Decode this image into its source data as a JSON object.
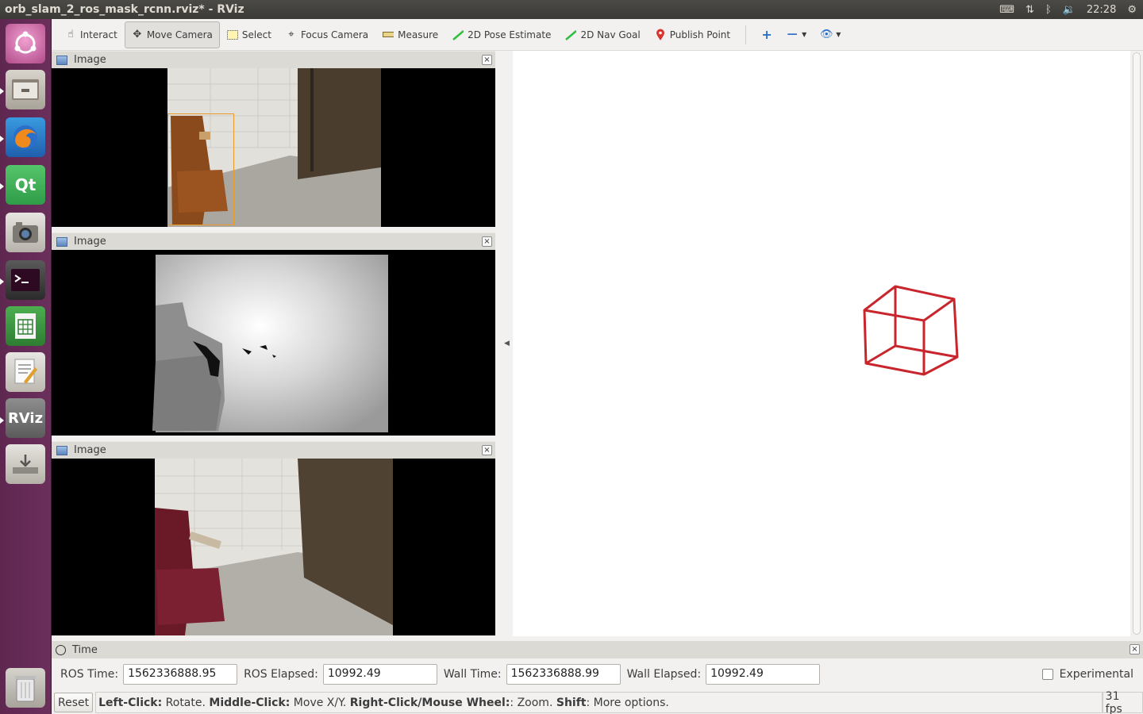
{
  "window": {
    "title": "orb_slam_2_ros_mask_rcnn.rviz* - RViz",
    "clock": "22:28"
  },
  "launcher": {
    "items": [
      "ubuntu-icon",
      "files-icon",
      "firefox-icon",
      "qt-creator-icon",
      "camera-icon",
      "terminal-icon",
      "spreadsheet-icon",
      "text-editor-icon",
      "rviz-icon",
      "installer-icon",
      "trash-icon"
    ],
    "qt_label": "Qt",
    "rviz_label": "RViz"
  },
  "toolbar": {
    "tools": {
      "interact": "Interact",
      "move_camera": "Move Camera",
      "select": "Select",
      "focus_camera": "Focus Camera",
      "measure": "Measure",
      "pose_estimate": "2D Pose Estimate",
      "nav_goal": "2D Nav Goal",
      "publish_point": "Publish Point"
    },
    "active_tool": "Move Camera"
  },
  "panels": {
    "image1_title": "Image",
    "image2_title": "Image",
    "image3_title": "Image",
    "close_glyph": "×"
  },
  "time_panel": {
    "title": "Time",
    "ros_time_label": "ROS Time:",
    "ros_time_value": "1562336888.95",
    "ros_elapsed_label": "ROS Elapsed:",
    "ros_elapsed_value": "10992.49",
    "wall_time_label": "Wall Time:",
    "wall_time_value": "1562336888.99",
    "wall_elapsed_label": "Wall Elapsed:",
    "wall_elapsed_value": "10992.49",
    "experimental_label": "Experimental",
    "experimental_checked": false
  },
  "status_bar": {
    "reset_label": "Reset",
    "left_click": "Left-Click:",
    "left_click_desc": " Rotate. ",
    "middle_click": "Middle-Click:",
    "middle_click_desc": " Move X/Y. ",
    "right_click": "Right-Click/Mouse Wheel:",
    "right_click_desc": ": Zoom. ",
    "shift": "Shift",
    "shift_desc": ": More options.",
    "fps": "31 fps"
  },
  "colors": {
    "camera_frustum": "#c8262c",
    "launcher_bg": "#5e2750",
    "detection_box": "#e89a2a"
  }
}
